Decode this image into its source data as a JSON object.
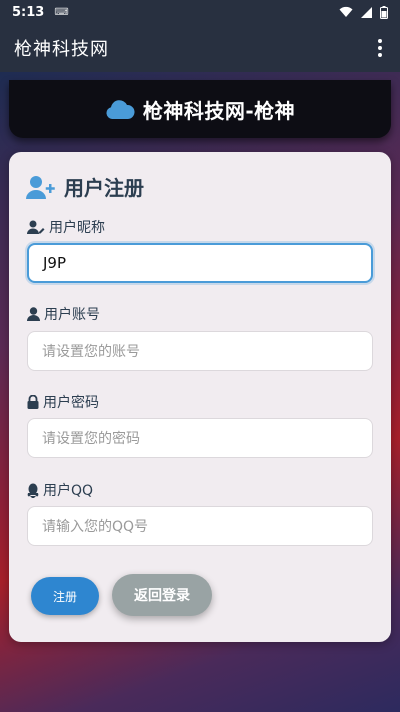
{
  "status_bar": {
    "time": "5:13",
    "keyboard_indicator": "⌨"
  },
  "app_bar": {
    "title": "枪神科技网"
  },
  "banner": {
    "title": "枪神科技网-枪神"
  },
  "form": {
    "title": "用户注册",
    "fields": [
      {
        "label": "用户昵称",
        "value": "J9P",
        "placeholder": ""
      },
      {
        "label": "用户账号",
        "value": "",
        "placeholder": "请设置您的账号"
      },
      {
        "label": "用户密码",
        "value": "",
        "placeholder": "请设置您的密码"
      },
      {
        "label": "用户QQ",
        "value": "",
        "placeholder": "请输入您的QQ号"
      }
    ],
    "register_label": "注册",
    "back_label": "返回登录"
  },
  "colors": {
    "accent": "#2e86d0",
    "focus_border": "#4a9bd8",
    "heading": "#2c3e50",
    "secondary_button": "#99a3a4"
  },
  "icons": {
    "banner": "cloud-icon",
    "form_title": "user-plus-icon",
    "nickname": "user-edit-icon",
    "account": "user-icon",
    "password": "lock-icon",
    "qq": "qq-penguin-icon"
  }
}
